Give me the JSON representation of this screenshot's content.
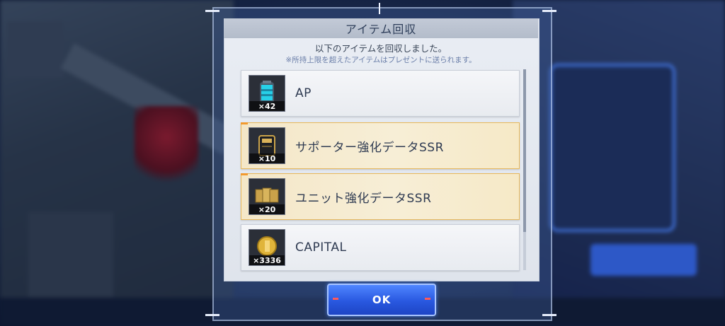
{
  "dialog": {
    "title": "アイテム回収",
    "message": "以下のアイテムを回収しました。",
    "note": "※所持上限を超えたアイテムはプレゼントに送られます。",
    "ok_label": "OK"
  },
  "items": [
    {
      "name": "AP",
      "quantity": "×42",
      "icon": "ap-canister-icon",
      "rarity": "normal"
    },
    {
      "name": "サポーター強化データSSR",
      "quantity": "×10",
      "icon": "supporter-data-icon",
      "rarity": "gold"
    },
    {
      "name": "ユニット強化データSSR",
      "quantity": "×20",
      "icon": "unit-data-icon",
      "rarity": "gold"
    },
    {
      "name": "CAPITAL",
      "quantity": "×3336",
      "icon": "capital-coin-icon",
      "rarity": "normal"
    }
  ],
  "colors": {
    "accent": "#2958e0",
    "gold_border": "#e8b85a",
    "panel": "#e9edf4"
  }
}
